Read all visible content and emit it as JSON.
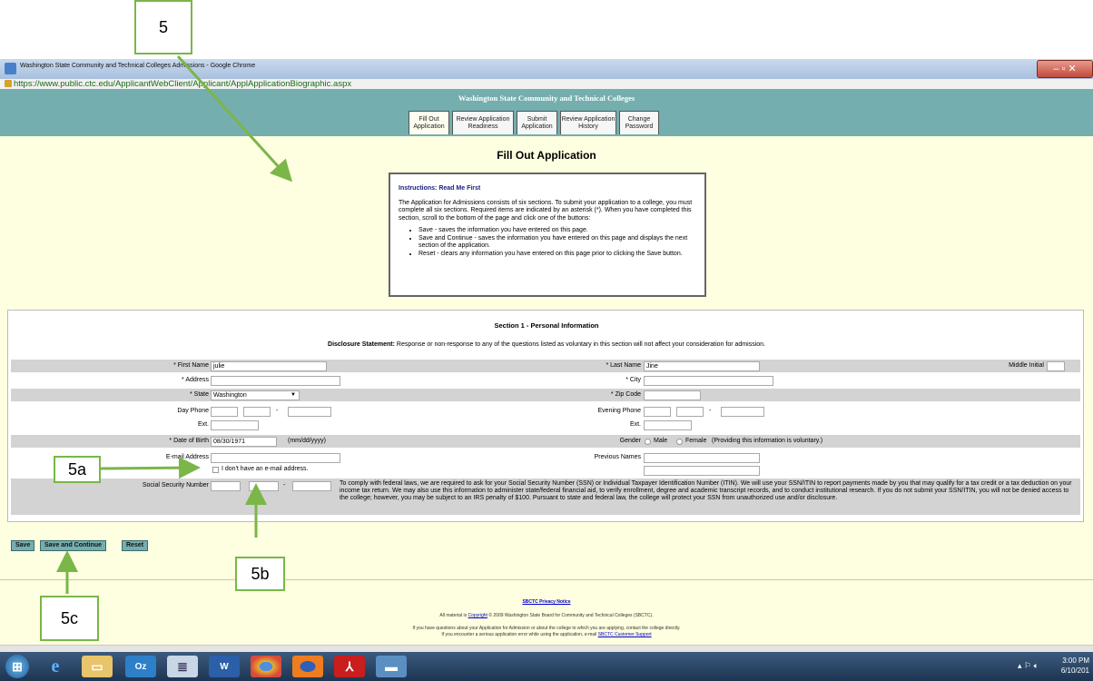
{
  "callouts": {
    "c5": "5",
    "c5a": "5a",
    "c5b": "5b",
    "c5c": "5c"
  },
  "window": {
    "title": "Washington State Community and Technical Colleges Admissions - Google Chrome",
    "url": "https://www.public.ctc.edu/ApplicantWebClient/Applicant/ApplApplicationBiographic.aspx"
  },
  "header": {
    "site_title": "Washington State Community and Technical Colleges",
    "tabs": [
      {
        "label": "Fill Out\nApplication"
      },
      {
        "label": "Review Application\nReadiness"
      },
      {
        "label": "Submit\nApplication"
      },
      {
        "label": "Review Application\nHistory"
      },
      {
        "label": "Change\nPassword"
      }
    ]
  },
  "main": {
    "heading": "Fill Out Application",
    "instructions": {
      "title": "Instructions: Read Me First",
      "body": "The Application for Admissions consists of six sections. To submit your application to a college, you must complete all six sections. Required items are indicated by an asterisk (*). When you have completed this section, scroll to the bottom of the page and click one of the buttons:",
      "bullets": [
        "Save - saves the information you have entered on this page.",
        "Save and Continue - saves the information you have entered on this page and displays the next section of the application.",
        "Reset - clears any information you have entered on this page prior to clicking the Save button."
      ]
    }
  },
  "section": {
    "title": "Section 1 - Personal Information",
    "disclosure_label": "Disclosure Statement:",
    "disclosure_text": "Response or non-response to any of the questions listed as voluntary in this section will not affect your consideration for admission.",
    "fields": {
      "first_name_label": "* First Name",
      "first_name_value": "julie",
      "last_name_label": "* Last Name",
      "last_name_value": "Jine",
      "middle_initial_label": "Middle Initial",
      "address_label": "* Address",
      "city_label": "* City",
      "state_label": "* State",
      "state_value": "Washington",
      "zip_label": "* Zip Code",
      "day_phone_label": "Day Phone",
      "evening_phone_label": "Evening Phone",
      "ext_label": "Ext.",
      "dash": "-",
      "dob_label": "* Date of Birth",
      "dob_value": "08/30/1971",
      "dob_format": "(mm/dd/yyyy)",
      "gender_label": "Gender",
      "gender_male": "Male",
      "gender_female": "Female",
      "gender_note": "(Providing this information is voluntary.)",
      "email_label": "E-mail Address",
      "no_email_label": "I don't have an e-mail address.",
      "previous_names_label": "Previous Names",
      "ssn_label": "Social Security Number",
      "ssn_note": "To comply with federal laws, we are required to ask for your Social Security Number (SSN) or Individual Taxpayer Identification Number (ITIN). We will use your SSN/ITIN to report payments made by you that may qualify for a tax credit or a tax deduction on your income tax return. We may also use this information to administer state/federal financial aid, to verify enrollment, degree and academic transcript records, and to conduct institutional research. If you do not submit your SSN/ITIN, you will not be denied access to the college; however, you may be subject to an IRS penalty of $100. Pursuant to state and federal law, the college will protect your SSN from unauthorized use and/or disclosure."
    }
  },
  "buttons": {
    "save": "Save",
    "save_continue": "Save and Continue",
    "reset": "Reset"
  },
  "footer": {
    "privacy": "SBCTC Privacy Notice",
    "copyright_pre": "All material is",
    "copyright_link": "Copyright",
    "copyright_post": "© 2009 Washington State Board for Community and Technical Colleges (SBCTC).",
    "help_line1": "If you have questions about your Application for Admission or about the college to which you are applying, contact the college directly.",
    "help_line2_pre": "If you encounter a serious application error while using the application, e-mail",
    "help_line2_link": "SBCTC Customer Support"
  },
  "taskbar": {
    "time": "3:00 PM",
    "date": "6/10/201"
  }
}
